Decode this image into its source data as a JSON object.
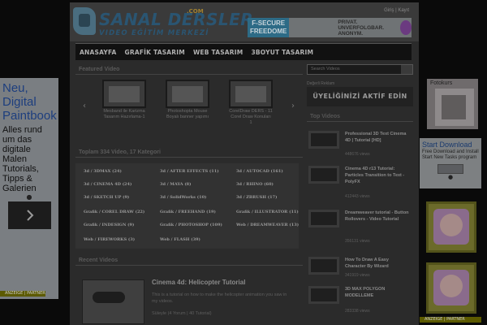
{
  "header": {
    "logo_main": "SANAL DERSLER",
    "logo_com": ".COM",
    "logo_sub": "VIDEO EĞİTİM MERKEZİ",
    "ad_brand": "F-SECURE FREEDOME",
    "ad_slogan": "PRIVAT. UNVERFOLGBAR. ANONYM.",
    "links": "Giriş | Kayıt"
  },
  "nav": [
    "ANASAYFA",
    "GRAFİK TASARIM",
    "WEB TASARIM",
    "3BOYUT TASARIM"
  ],
  "featured": {
    "title": "Featured Video",
    "prev": "‹",
    "next": "›",
    "items": [
      {
        "caption": "Mesband ile Karizma Tasarım Hazırlama-1"
      },
      {
        "caption": "Photoshopta Mouse Boyalı banner yapımı"
      },
      {
        "caption": "CorelDraw DERS - 11 Corel Draw Konuları 1"
      }
    ]
  },
  "categories": {
    "title": "Toplam 334 Video, 17 Kategori",
    "rows": [
      [
        "3d / 3DMAX (24)",
        "3d / AFTER EFFECTS (11)",
        "3d / AUTOCAD (161)"
      ],
      [
        "3d / CINEMA 4D (24)",
        "3d / MAYA (8)",
        "3d / RHINO (60)"
      ],
      [
        "3d / SKETCH UP (9)",
        "3d / SolidWorks (10)",
        "3d / ZBRUSH (17)"
      ],
      [
        "Grafik / COREL DRAW (22)",
        "Grafik / FREEHAND (19)",
        "Grafik / ILLUSTRATOR (11)"
      ],
      [
        "Grafik / INDESIGN (9)",
        "Grafik / PHOTOSHOP (109)",
        "Web / DREAMWEAVER (13)"
      ],
      [
        "Web / FIREWORKS (3)",
        "Web / FLASH (39)"
      ]
    ]
  },
  "recent": {
    "title": "Recent Videos",
    "video_title": "Cinema 4d: Helicopter Tutorial",
    "desc": "This is a tutorial on how to make the helicopter animation you saw in my videos.",
    "meta": "Süleyle (4 Yorum | 40 Tutorial)"
  },
  "sidebar": {
    "search_placeholder": "Search Videos",
    "sponsor": "Değerli Reklam",
    "member_banner": "ÜYELİĞİNİZİ AKTİF EDİN",
    "top_videos_title": "Top Videos",
    "items": [
      {
        "title": "Professional 3D Text Cinema 4D | Tutorial [HD]",
        "views": "448676 views"
      },
      {
        "title": "Cinema 4D r13 Tutorial: Particles Transition to Text - PolyFX",
        "views": "412443 views"
      },
      {
        "title": "Dreamweaver tutorial - Button Rollovers - Video Tutorial",
        "views": "356131 views"
      },
      {
        "title": "How To Draw A Easy Character By Wizard",
        "views": "341919 views"
      },
      {
        "title": "3D MAX POLYGON MODELLEME",
        "views": "283338 views"
      }
    ]
  },
  "left_ad": {
    "title": "Neu, Digital Paintbook",
    "body": "Alles rund um das digitale Malen Tutorials, Tipps & Galerien",
    "dot": "●",
    "arrow": "›",
    "strip": "ANZEIGE | PARTNER"
  },
  "right_ads": {
    "tag1": "Fotokurs",
    "download_title": "Start Download",
    "download_sub": "Free Download and Install Start New Tasks program",
    "dot": "●",
    "strip": "ANZEIGE | PARTNER"
  },
  "colors": {
    "page_bg": "#0a0a0a",
    "main_bg": "#2b2b2b",
    "nav_bg": "#111111",
    "logo_blue": "#2a5572"
  }
}
